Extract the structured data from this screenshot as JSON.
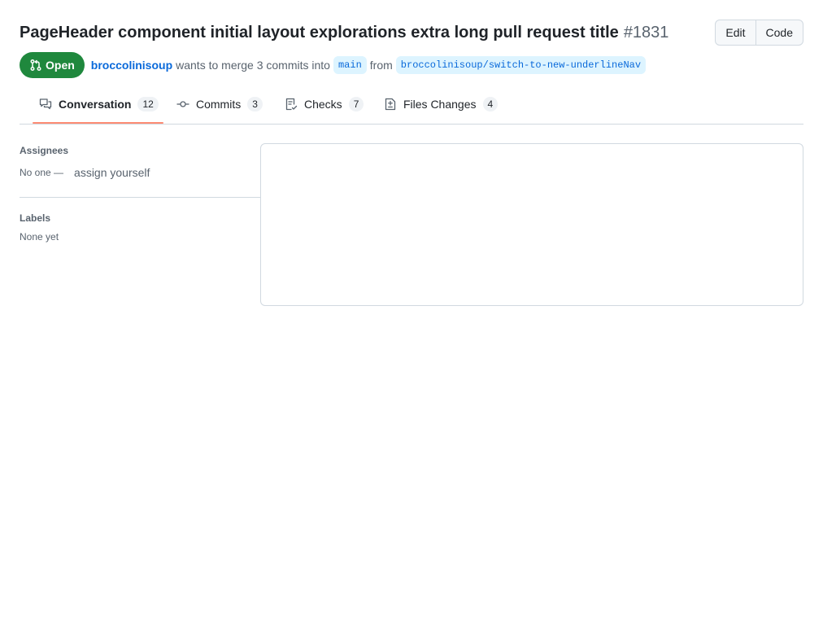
{
  "header": {
    "title": "PageHeader component initial layout explorations extra long pull request title",
    "number": "#1831",
    "edit_label": "Edit",
    "code_label": "Code"
  },
  "meta": {
    "state": "Open",
    "author": "broccolinisoup",
    "merge_text": "wants to merge 3 commits into",
    "base_branch": "main",
    "from_text": "from",
    "head_branch": "broccolinisoup/switch-to-new-underlineNav"
  },
  "tabs": [
    {
      "label": "Conversation",
      "count": "12",
      "icon": "comment-discussion-icon",
      "selected": true
    },
    {
      "label": "Commits",
      "count": "3",
      "icon": "git-commit-icon"
    },
    {
      "label": "Checks",
      "count": "7",
      "icon": "checklist-icon"
    },
    {
      "label": "Files Changes",
      "count": "4",
      "icon": "file-diff-icon"
    }
  ],
  "sidebar": {
    "assignees_title": "Assignees",
    "assignees_value": "No one —",
    "assign_yourself": "assign yourself",
    "labels_title": "Labels",
    "labels_value": "None yet"
  },
  "colors": {
    "open_green": "#1f883d",
    "link_blue": "#0969da",
    "tab_underline": "#fd8c73",
    "branch_bg": "#ddf4ff"
  }
}
